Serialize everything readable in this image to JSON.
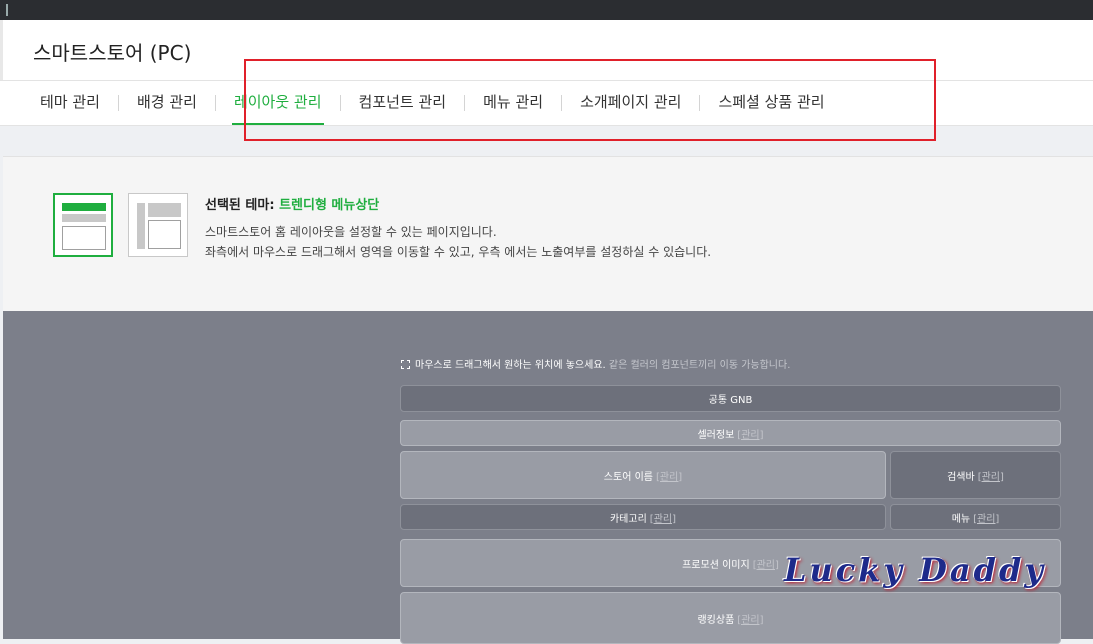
{
  "app": {
    "title": "스마트스토어 (PC)"
  },
  "tabs": [
    {
      "label": "테마 관리"
    },
    {
      "label": "배경 관리"
    },
    {
      "label": "레이아웃 관리"
    },
    {
      "label": "컴포넌트 관리"
    },
    {
      "label": "메뉴 관리"
    },
    {
      "label": "소개페이지 관리"
    },
    {
      "label": "스페셜 상품 관리"
    }
  ],
  "active_tab": "레이아웃 관리",
  "theme": {
    "label": "선택된 테마:",
    "name": "트렌디형 메뉴상단",
    "desc1": "스마트스토어 홈 레이아웃을 설정할 수 있는 페이지입니다.",
    "desc2": "좌측에서 마우스로 드래그해서 영역을 이동할 수 있고, 우측 에서는 노출여부를 설정하실 수 있습니다."
  },
  "hint": {
    "main": "마우스로 드래그해서 원하는 위치에 놓으세요.",
    "sub": "같은 컬러의 컴포넌트끼리 이동 가능합니다."
  },
  "blocks": {
    "manage": "[관리]",
    "gnb": "공통 GNB",
    "seller": "셀러정보",
    "store_name": "스토어 이름",
    "search_bar": "검색바",
    "category": "카테고리",
    "menu": "메뉴",
    "promotion": "프로모션 이미지",
    "ranking": "랭킹상품"
  },
  "watermark": "Lucky Daddy",
  "colors": {
    "accent": "#1fae3f",
    "highlight": "#e0202a",
    "canvas": "#7c7f8a"
  }
}
